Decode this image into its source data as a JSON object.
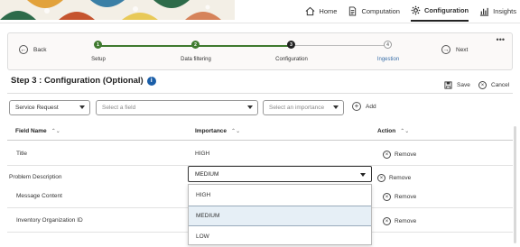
{
  "nav": {
    "items": [
      {
        "label": "Home",
        "icon": "home-icon"
      },
      {
        "label": "Computation",
        "icon": "document-icon"
      },
      {
        "label": "Configuration",
        "icon": "gear-icon",
        "active": true
      },
      {
        "label": "Insights",
        "icon": "bar-chart-icon"
      }
    ]
  },
  "wizard": {
    "back_label": "Back",
    "next_label": "Next",
    "more_label": "•••",
    "steps": [
      {
        "num": "1",
        "label": "Setup",
        "state": "done"
      },
      {
        "num": "2",
        "label": "Data filtering",
        "state": "done"
      },
      {
        "num": "3",
        "label": "Configuration",
        "state": "current"
      },
      {
        "num": "4",
        "label": "Ingestion",
        "state": "upcoming"
      }
    ]
  },
  "page": {
    "title": "Step 3 : Configuration (Optional)",
    "info_glyph": "i",
    "save_label": "Save",
    "cancel_label": "Cancel"
  },
  "filters": {
    "object_value": "Service Request",
    "field_placeholder": "Select a field",
    "importance_placeholder": "Select an importance",
    "add_label": "Add"
  },
  "table": {
    "headers": {
      "field": "Field Name",
      "importance": "Importance",
      "action": "Action"
    },
    "sort_glyph": "⌃⌄",
    "rows": [
      {
        "field": "Title",
        "importance": "HIGH",
        "action": "Remove"
      },
      {
        "field": "Problem Description",
        "importance": "MEDIUM",
        "action": "Remove"
      },
      {
        "field": "Message Content",
        "importance": "",
        "action": "Remove"
      },
      {
        "field": "Inventory Organization ID",
        "importance": "",
        "action": "Remove"
      }
    ]
  },
  "dropdown": {
    "options": [
      "HIGH",
      "MEDIUM",
      "LOW"
    ],
    "selected": "MEDIUM"
  },
  "colors": {
    "accent_green": "#3f7a2f",
    "info_blue": "#1a5ea8",
    "link_blue": "#3a6fa8",
    "selected_option_bg": "#e6eff6"
  }
}
